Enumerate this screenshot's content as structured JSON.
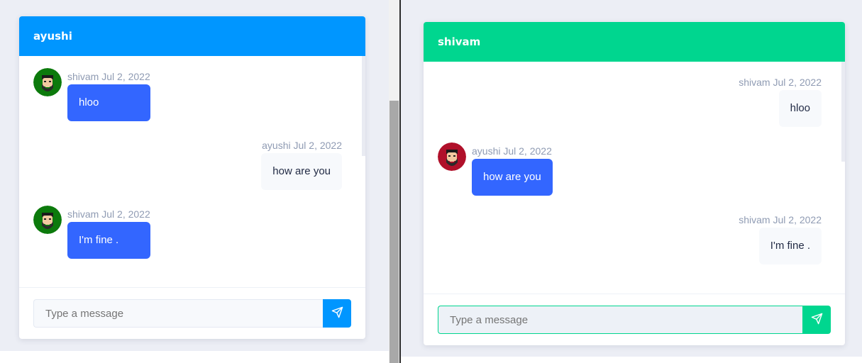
{
  "colors": {
    "left_header": "#0096ff",
    "right_header": "#00d68f",
    "bubble_mine": "#3366ff",
    "bubble_theirs": "#f7f9fc"
  },
  "left_chat": {
    "title": "ayushi",
    "messages": [
      {
        "sender": "shivam",
        "date": "Jul 2, 2022",
        "text": "hloo",
        "avatar": "bearded-man-avatar-green"
      },
      {
        "sender": "ayushi",
        "date": "Jul 2, 2022",
        "text": "how are you"
      },
      {
        "sender": "shivam",
        "date": "Jul 2, 2022",
        "text": "I'm fine .",
        "avatar": "bearded-man-avatar-green"
      }
    ],
    "input_placeholder": "Type a message",
    "send_icon": "send-icon"
  },
  "right_chat": {
    "title": "shivam",
    "messages": [
      {
        "sender": "shivam",
        "date": "Jul 2, 2022",
        "text": "hloo"
      },
      {
        "sender": "ayushi",
        "date": "Jul 2, 2022",
        "text": "how are you",
        "avatar": "bearded-man-avatar-red"
      },
      {
        "sender": "shivam",
        "date": "Jul 2, 2022",
        "text": "I'm fine ."
      }
    ],
    "input_placeholder": "Type a message",
    "send_icon": "send-icon"
  }
}
